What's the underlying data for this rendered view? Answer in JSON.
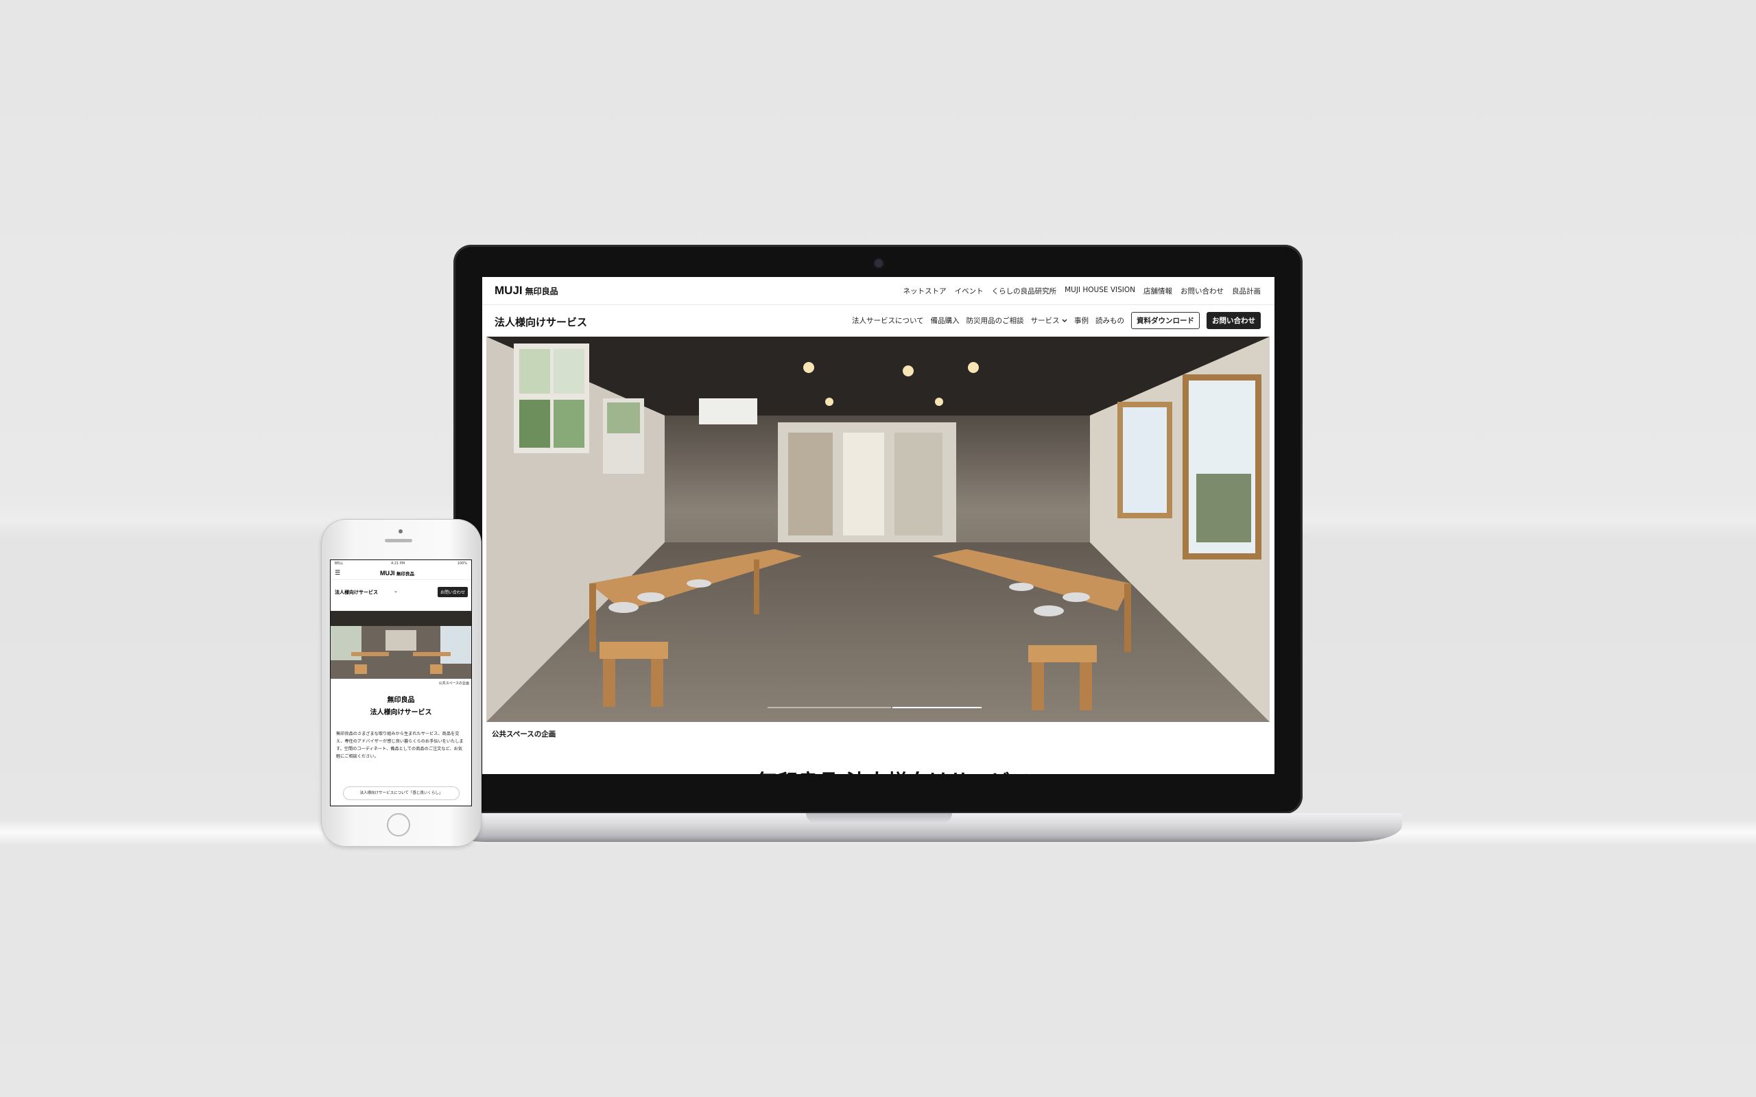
{
  "desktop": {
    "brand": {
      "latin": "MUJI",
      "jp": "無印良品"
    },
    "top_links": [
      "ネットストア",
      "イベント",
      "くらしの良品研究所",
      "MUJI HOUSE VISION",
      "店舗情報",
      "お問い合わせ",
      "良品計画"
    ],
    "service_title": "法人様向けサービス",
    "sub_nav": {
      "items": [
        "法人サービスについて",
        "備品購入",
        "防災用品のご相談"
      ],
      "services_label": "サービス",
      "case_label": "事例",
      "reading_label": "読みもの",
      "download_label": "資料ダウンロード",
      "contact_label": "お問い合わせ"
    },
    "hero_caption": "公共スペースの企画",
    "section_heading": "無印良品 法人様向けサービス"
  },
  "mobile": {
    "status": {
      "carrier": "BELL",
      "time": "4:21 PM",
      "battery": "100%"
    },
    "brand": {
      "latin": "MUJI",
      "jp": "無印良品"
    },
    "service_title": "法人様向けサービス",
    "contact_label": "お問い合わせ",
    "hero_caption": "公共スペースの企画",
    "heading_line1": "無印良品",
    "heading_line2": "法人様向けサービス",
    "body": "無印良品のさまざまな取り組みから生まれたサービス、商品を交え、専任のアドバイザーが感じ良い暮らくらのお手伝いをいたします。空間のコーディネート、備品としての商品のご注文など、お気軽にご相談ください。",
    "pill_label": "法人様向けサービスについて「感じ良いくらし」"
  },
  "hero_slides": {
    "count": 2,
    "active": 2
  }
}
